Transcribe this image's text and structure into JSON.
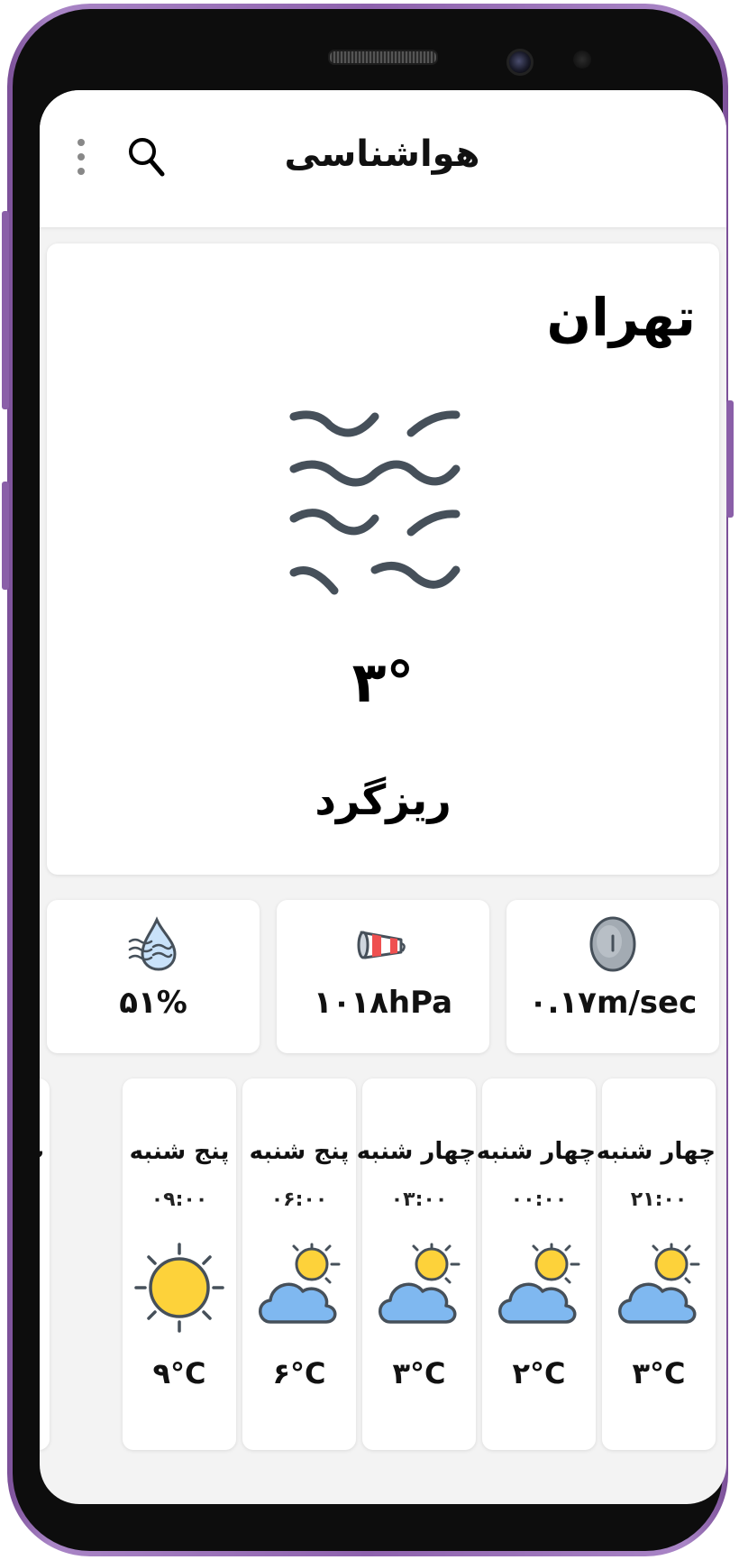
{
  "app": {
    "title": "هواشناسی"
  },
  "current": {
    "city": "تهران",
    "temperature": "۳°",
    "description": "ریزگرد",
    "icon": "dust-waves-icon"
  },
  "stats": [
    {
      "name": "humidity",
      "icon": "humidity-drop-icon",
      "value": "۵۱%"
    },
    {
      "name": "pressure",
      "icon": "windsock-icon",
      "value": "۱۰۱۸hPa"
    },
    {
      "name": "wind",
      "icon": "wind-speed-icon",
      "value": "۰.۱۷m/sec"
    }
  ],
  "forecast": [
    {
      "day": "چهار شنبه",
      "time": "۲۱:۰۰",
      "temp": "۳°C",
      "icon": "partly-cloudy-icon"
    },
    {
      "day": "چهار شنبه",
      "time": "۰۰:۰۰",
      "temp": "۲°C",
      "icon": "partly-cloudy-icon"
    },
    {
      "day": "چهار شنبه",
      "time": "۰۳:۰۰",
      "temp": "۳°C",
      "icon": "partly-cloudy-icon"
    },
    {
      "day": "پنج شنبه",
      "time": "۰۶:۰۰",
      "temp": "۶°C",
      "icon": "partly-cloudy-icon"
    },
    {
      "day": "پنج شنبه",
      "time": "۰۹:۰۰",
      "temp": "۹°C",
      "icon": "sun-icon"
    },
    {
      "day": "پ",
      "time": "",
      "temp": "",
      "icon": "sun-icon"
    }
  ],
  "colors": {
    "device_frame": "#8e62ad",
    "screen_background": "#f3f3f3",
    "card": "#ffffff",
    "icon_dark": "#46505a",
    "cloud_blue": "#7fb8f0",
    "sun_yellow": "#fdd23a"
  }
}
